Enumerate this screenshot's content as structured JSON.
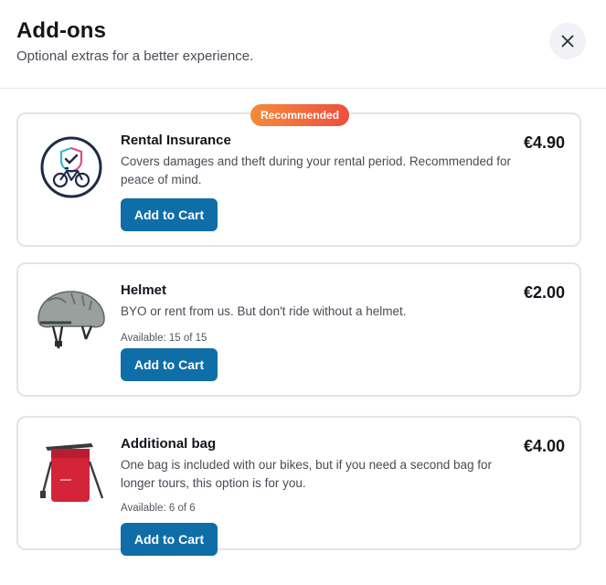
{
  "header": {
    "title": "Add-ons",
    "subtitle": "Optional extras for a better experience."
  },
  "addons": [
    {
      "badge": "Recommended",
      "name": "Rental Insurance",
      "description": "Covers damages and theft during your rental period. Recommended for peace of mind.",
      "price": "€4.90",
      "button_label": "Add to Cart",
      "icon": "bike-insurance-icon"
    },
    {
      "name": "Helmet",
      "description": "BYO or rent from us. But don't ride without a helmet.",
      "availability": "Available: 15 of 15",
      "price": "€2.00",
      "button_label": "Add to Cart",
      "image": "helmet-image"
    },
    {
      "name": "Additional bag",
      "description": "One bag is included with our bikes, but if you need a second bag for longer tours, this option is for you.",
      "availability": "Available: 6 of 6",
      "price": "€4.00",
      "button_label": "Add to Cart",
      "image": "pannier-bag-image"
    }
  ],
  "colors": {
    "primary_button": "#0f6ea7",
    "badge_gradient_start": "#f58a3a",
    "badge_gradient_end": "#ee4f3f",
    "card_border": "#e4e4e7"
  }
}
